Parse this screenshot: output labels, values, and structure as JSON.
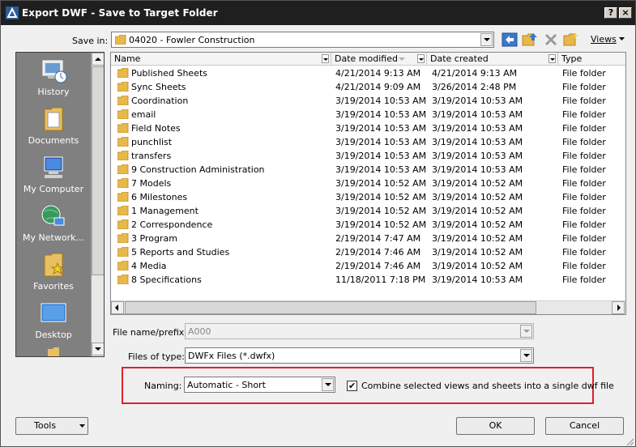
{
  "window": {
    "title": "Export DWF - Save to Target Folder",
    "help_label": "?",
    "close_label": "×"
  },
  "save_in": {
    "label": "Save in:",
    "value": "04020 - Fowler Construction",
    "views_label": "Views"
  },
  "places": [
    {
      "label": "History",
      "icon": "history-icon"
    },
    {
      "label": "Documents",
      "icon": "documents-icon"
    },
    {
      "label": "My Computer",
      "icon": "computer-icon"
    },
    {
      "label": "My Network...",
      "icon": "network-icon"
    },
    {
      "label": "Favorites",
      "icon": "favorites-icon"
    },
    {
      "label": "Desktop",
      "icon": "desktop-icon"
    }
  ],
  "columns": {
    "name": "Name",
    "date_modified": "Date modified",
    "date_created": "Date created",
    "type": "Type"
  },
  "files": [
    {
      "name": "Published Sheets",
      "modified": "4/21/2014 9:13 AM",
      "created": "4/21/2014 9:13 AM",
      "type": "File folder"
    },
    {
      "name": "Sync Sheets",
      "modified": "4/21/2014 9:09 AM",
      "created": "3/26/2014 2:48 PM",
      "type": "File folder"
    },
    {
      "name": "Coordination",
      "modified": "3/19/2014 10:53 AM",
      "created": "3/19/2014 10:53 AM",
      "type": "File folder"
    },
    {
      "name": "email",
      "modified": "3/19/2014 10:53 AM",
      "created": "3/19/2014 10:53 AM",
      "type": "File folder"
    },
    {
      "name": "Field Notes",
      "modified": "3/19/2014 10:53 AM",
      "created": "3/19/2014 10:53 AM",
      "type": "File folder"
    },
    {
      "name": "punchlist",
      "modified": "3/19/2014 10:53 AM",
      "created": "3/19/2014 10:53 AM",
      "type": "File folder"
    },
    {
      "name": "transfers",
      "modified": "3/19/2014 10:53 AM",
      "created": "3/19/2014 10:53 AM",
      "type": "File folder"
    },
    {
      "name": "9 Construction Administration",
      "modified": "3/19/2014 10:53 AM",
      "created": "3/19/2014 10:53 AM",
      "type": "File folder"
    },
    {
      "name": "7 Models",
      "modified": "3/19/2014 10:52 AM",
      "created": "3/19/2014 10:52 AM",
      "type": "File folder"
    },
    {
      "name": "6 Milestones",
      "modified": "3/19/2014 10:52 AM",
      "created": "3/19/2014 10:52 AM",
      "type": "File folder"
    },
    {
      "name": "1 Management",
      "modified": "3/19/2014 10:52 AM",
      "created": "3/19/2014 10:52 AM",
      "type": "File folder"
    },
    {
      "name": "2 Correspondence",
      "modified": "3/19/2014 10:52 AM",
      "created": "3/19/2014 10:52 AM",
      "type": "File folder"
    },
    {
      "name": "3 Program",
      "modified": "2/19/2014 7:47 AM",
      "created": "3/19/2014 10:52 AM",
      "type": "File folder"
    },
    {
      "name": "5 Reports and Studies",
      "modified": "2/19/2014 7:46 AM",
      "created": "3/19/2014 10:52 AM",
      "type": "File folder"
    },
    {
      "name": "4 Media",
      "modified": "2/19/2014 7:46 AM",
      "created": "3/19/2014 10:52 AM",
      "type": "File folder"
    },
    {
      "name": "8 Specifications",
      "modified": "11/18/2011 7:18 PM",
      "created": "3/19/2014 10:53 AM",
      "type": "File folder"
    }
  ],
  "file_name": {
    "label": "File name/prefix:",
    "value": "A000"
  },
  "files_of_type": {
    "label": "Files of type:",
    "value": "DWFx Files (*.dwfx)"
  },
  "naming": {
    "label": "Naming:",
    "value": "Automatic - Short"
  },
  "combine": {
    "label": "Combine selected views and sheets into a single dwf file",
    "checked": true,
    "check_glyph": "✔"
  },
  "buttons": {
    "tools": "Tools",
    "ok": "OK",
    "cancel": "Cancel"
  },
  "colors": {
    "titlebar": "#1f1f1f",
    "places_panel": "#808080",
    "highlight_box": "#e0202a",
    "folder": "#e8b84a"
  }
}
